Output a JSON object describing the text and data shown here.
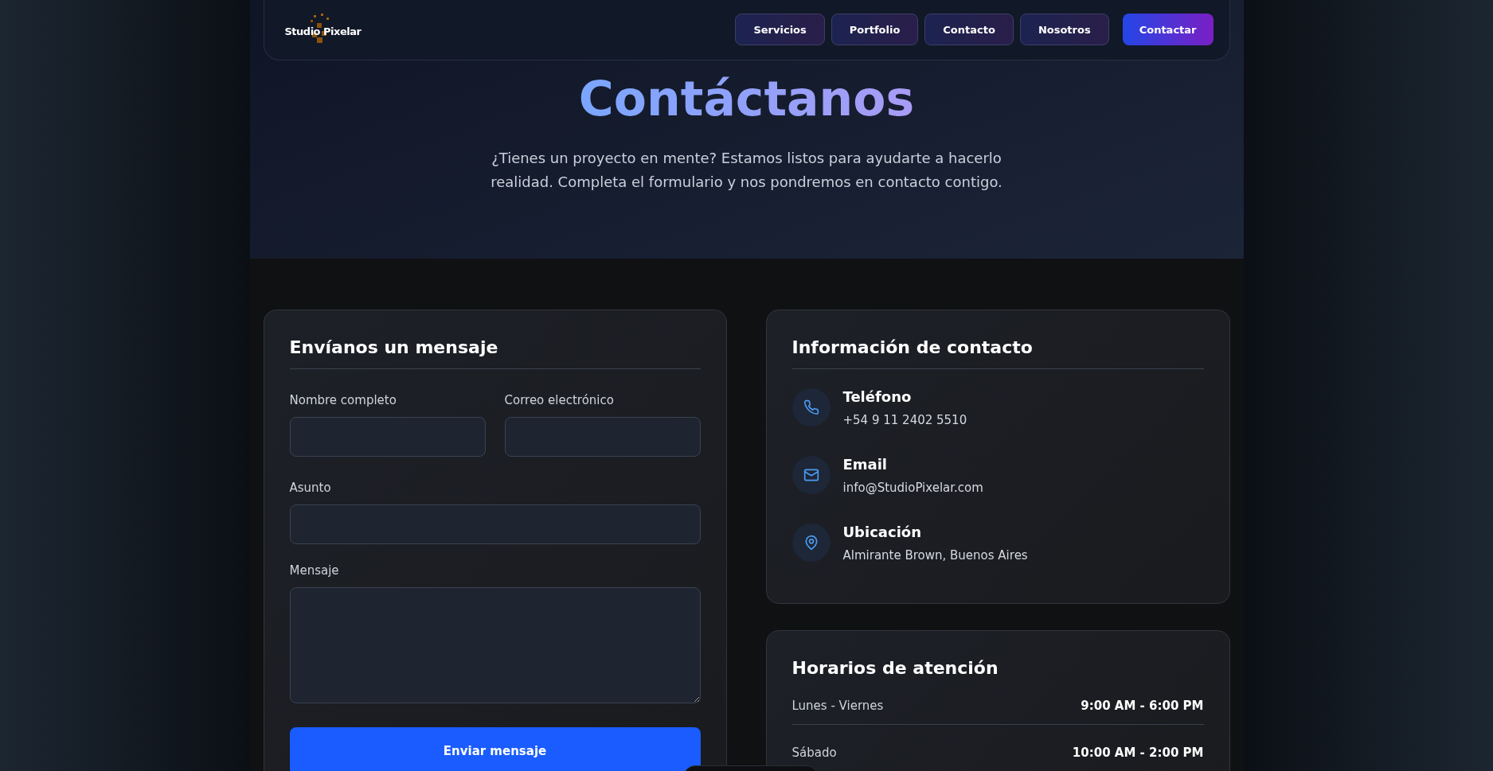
{
  "header": {
    "logo": "Studio Pixelar",
    "nav": [
      {
        "label": "Servicios",
        "kind": "link"
      },
      {
        "label": "Portfolio",
        "kind": "link"
      },
      {
        "label": "Contacto",
        "kind": "link"
      },
      {
        "label": "Nosotros",
        "kind": "link"
      },
      {
        "label": "Contactar",
        "kind": "cta"
      }
    ]
  },
  "hero": {
    "title": "Contáctanos",
    "subtitle": "¿Tienes un proyecto en mente? Estamos listos para ayudarte a hacerlo realidad. Completa el formulario y nos pondremos en contacto contigo."
  },
  "form": {
    "title": "Envíanos un mensaje",
    "fields": [
      {
        "label": "Nombre completo",
        "kind": "input"
      },
      {
        "label": "Correo electrónico",
        "kind": "input"
      },
      {
        "label": "Asunto",
        "kind": "input"
      },
      {
        "label": "Mensaje",
        "kind": "textarea"
      }
    ],
    "submit": "Enviar mensaje"
  },
  "contact_info": {
    "title": "Información de contacto",
    "items": [
      {
        "kind": "phone",
        "title": "Teléfono",
        "value": "+54 9 11 2402 5510"
      },
      {
        "kind": "email",
        "title": "Email",
        "value": "info@StudioPixelar.com"
      },
      {
        "kind": "location",
        "title": "Ubicación",
        "value": "Almirante Brown, Buenos Aires"
      }
    ]
  },
  "hours": {
    "title": "Horarios de atención",
    "rows": [
      {
        "day": "Lunes - Viernes",
        "time": "9:00 AM - 6:00 PM"
      },
      {
        "day": "Sábado",
        "time": "10:00 AM - 2:00 PM"
      }
    ]
  }
}
